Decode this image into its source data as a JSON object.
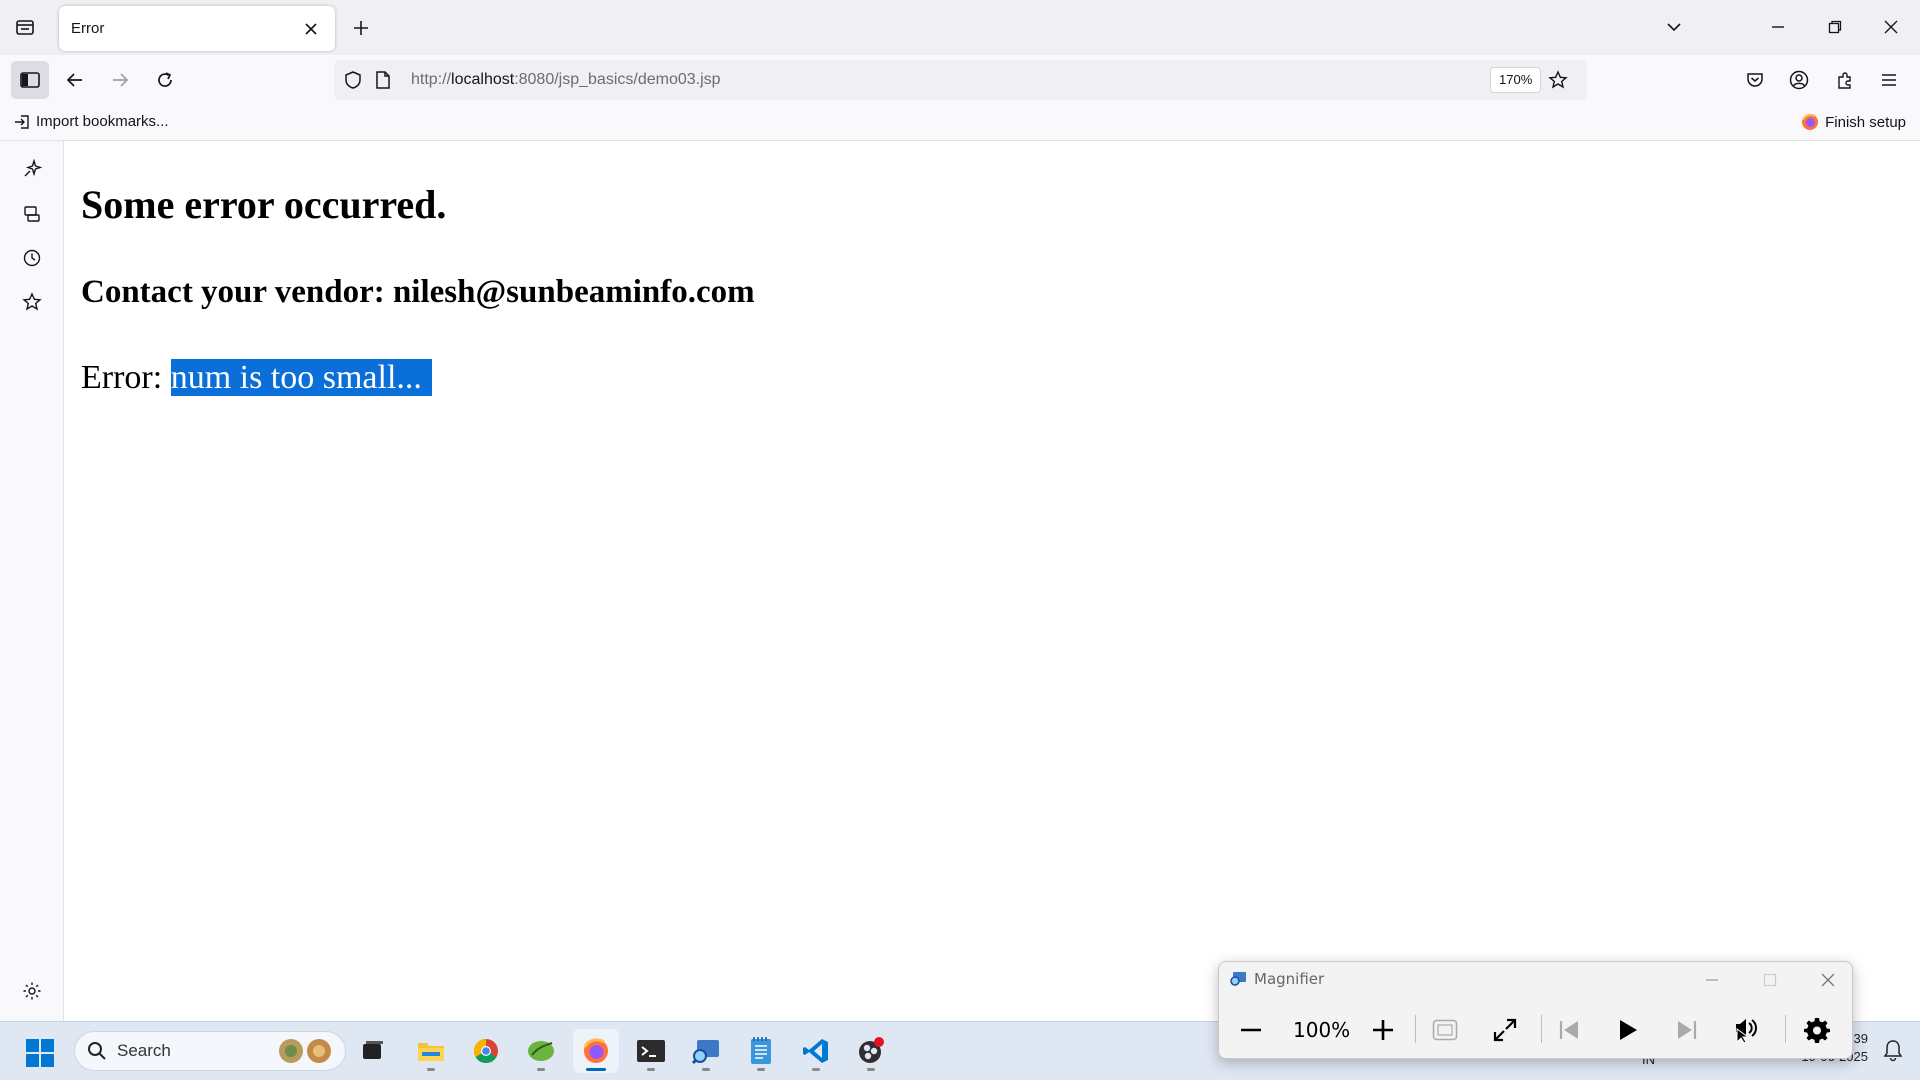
{
  "browser": {
    "tab": {
      "title": "Error"
    },
    "url": {
      "scheme": "http://",
      "host": "localhost",
      "rest": ":8080/jsp_basics/demo03.jsp"
    },
    "zoom": "170%"
  },
  "bookmarks": {
    "import_label": "Import bookmarks...",
    "finish_label": "Finish setup"
  },
  "page": {
    "heading": "Some error occurred.",
    "subheading": "Contact your vendor: nilesh@sunbeaminfo.com",
    "error_prefix": "Error: ",
    "error_message": "num is too small..."
  },
  "taskbar": {
    "search_placeholder": "Search",
    "clock_time": "39",
    "clock_date": "19-06-2025",
    "lang": "IN",
    "apps": [
      "task-view",
      "file-explorer",
      "chrome",
      "spring-tools",
      "firefox",
      "terminal",
      "magnifier",
      "notepad",
      "vscode",
      "obs"
    ]
  },
  "magnifier": {
    "title": "Magnifier",
    "zoom": "100%"
  },
  "colors": {
    "selection": "#0a6fd8",
    "taskbar": "#dfe7f3",
    "accent": "#0067c0"
  }
}
